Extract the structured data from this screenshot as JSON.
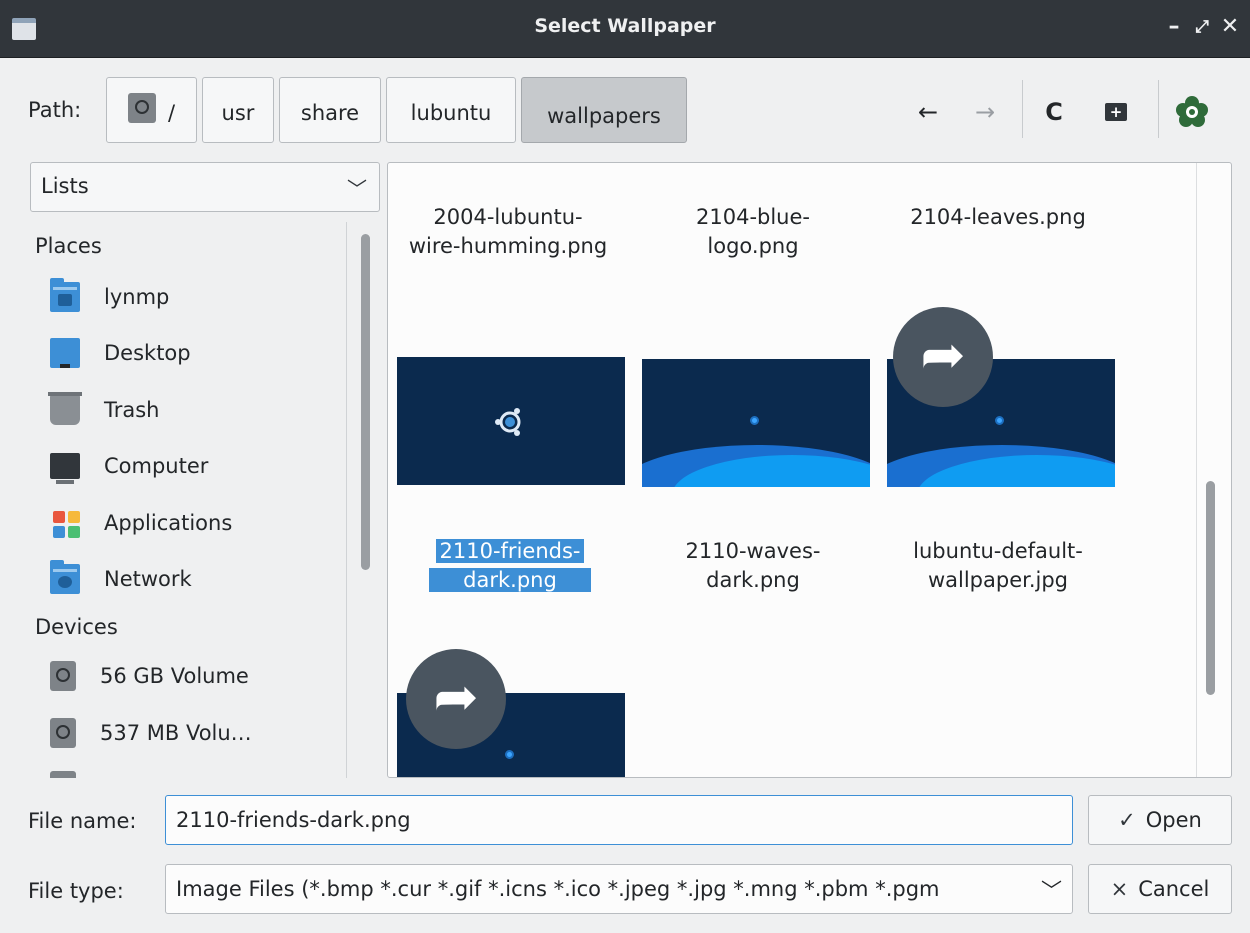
{
  "window": {
    "title": "Select Wallpaper"
  },
  "pathbar": {
    "label": "Path:",
    "crumbs": [
      "/",
      "usr",
      "share",
      "lubuntu",
      "wallpapers"
    ],
    "active_crumb": "wallpapers"
  },
  "toolbar": {
    "back_icon": "←",
    "forward_icon": "→",
    "reload_icon": "C"
  },
  "sidebar": {
    "view_mode": "Lists",
    "places_header": "Places",
    "places": [
      {
        "label": "lynmp",
        "icon": "home-folder-icon"
      },
      {
        "label": "Desktop",
        "icon": "desktop-icon"
      },
      {
        "label": "Trash",
        "icon": "trash-icon"
      },
      {
        "label": "Computer",
        "icon": "computer-icon"
      },
      {
        "label": "Applications",
        "icon": "applications-icon"
      },
      {
        "label": "Network",
        "icon": "network-folder-icon"
      }
    ],
    "devices_header": "Devices",
    "devices": [
      {
        "label": "56 GB Volume",
        "icon": "drive-icon"
      },
      {
        "label": "537 MB Volu…",
        "icon": "drive-icon"
      }
    ]
  },
  "files": {
    "row1": [
      {
        "line1": "2004-lubuntu-",
        "line2": "wire-humming.png"
      },
      {
        "line1": "2104-blue-",
        "line2": "logo.png"
      },
      {
        "line1": "2104-leaves.png",
        "line2": ""
      }
    ],
    "row2": [
      {
        "line1": "2110-friends-",
        "line2": "dark.png",
        "selected": true
      },
      {
        "line1": "2110-waves-",
        "line2": "dark.png"
      },
      {
        "line1": "lubuntu-default-",
        "line2": "wallpaper.jpg"
      }
    ]
  },
  "filename": {
    "label": "File name:",
    "value": "2110-friends-dark.png"
  },
  "filetype": {
    "label": "File type:",
    "value": "Image Files (*.bmp *.cur *.gif *.icns *.ico *.jpeg *.jpg *.mng *.pbm *.pgm"
  },
  "buttons": {
    "open": "Open",
    "open_glyph": "✓",
    "cancel": "Cancel",
    "cancel_glyph": "×"
  },
  "colors": {
    "accent": "#3d8fd6",
    "titlebar": "#31363b",
    "thumb_bg": "#0b2a4e"
  }
}
